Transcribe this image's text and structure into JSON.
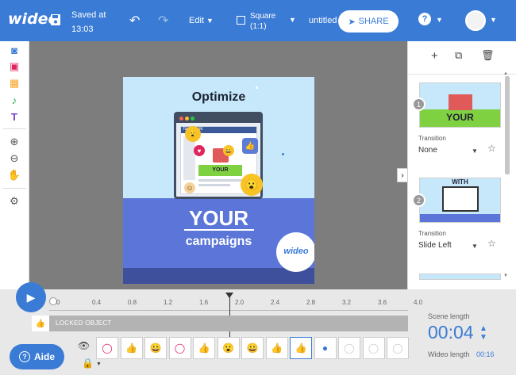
{
  "topbar": {
    "logo": "wideo",
    "saved_line1": "Saved at",
    "saved_line2": "13:03",
    "edit_label": "Edit",
    "aspect_line1": "Square",
    "aspect_line2": "(1:1)",
    "project_name": "untitled",
    "share_label": "SHARE",
    "help_label": "?"
  },
  "slide": {
    "title": "Optimize",
    "fb_text": "facebook",
    "banner": "YOUR",
    "big_text": "YOUR",
    "sub_text": "campaigns",
    "logo_small": "wideo"
  },
  "scenes": [
    {
      "number": "1",
      "thumb_text": "YOUR",
      "transition_label": "Transition",
      "transition_value": "None"
    },
    {
      "number": "2",
      "thumb_text": "WITH",
      "transition_label": "Transition",
      "transition_value": "Slide Left"
    }
  ],
  "timeline": {
    "ticks": [
      "0",
      "0.4",
      "0.8",
      "1.2",
      "1.6",
      "2.0",
      "2.4",
      "2.8",
      "3.2",
      "3.6",
      "4.0"
    ],
    "locked_label": "LOCKED OBJECT",
    "aide_label": "Aide",
    "scene_length_label": "Scene length",
    "scene_length_value": "00:04",
    "wideo_length_label": "Wideo length",
    "wideo_length_value": "00:16"
  }
}
